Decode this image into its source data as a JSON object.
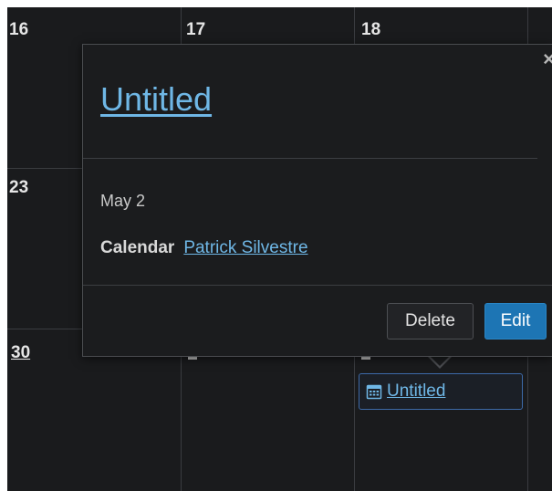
{
  "calendar": {
    "days": {
      "d16": "16",
      "d17": "17",
      "d18": "18",
      "d23": "23",
      "d30": "30"
    },
    "event_chip": {
      "label": "Untitled",
      "icon": "calendar-icon"
    }
  },
  "popover": {
    "close_label": "×",
    "title": "Untitled",
    "date": "May 2",
    "calendar_label": "Calendar",
    "calendar_name": "Patrick Silvestre",
    "delete_label": "Delete",
    "edit_label": "Edit"
  },
  "colors": {
    "background": "#1a1b1d",
    "link": "#6fb7e6",
    "primary_button": "#1d75b4",
    "grid": "#3a3c40"
  }
}
